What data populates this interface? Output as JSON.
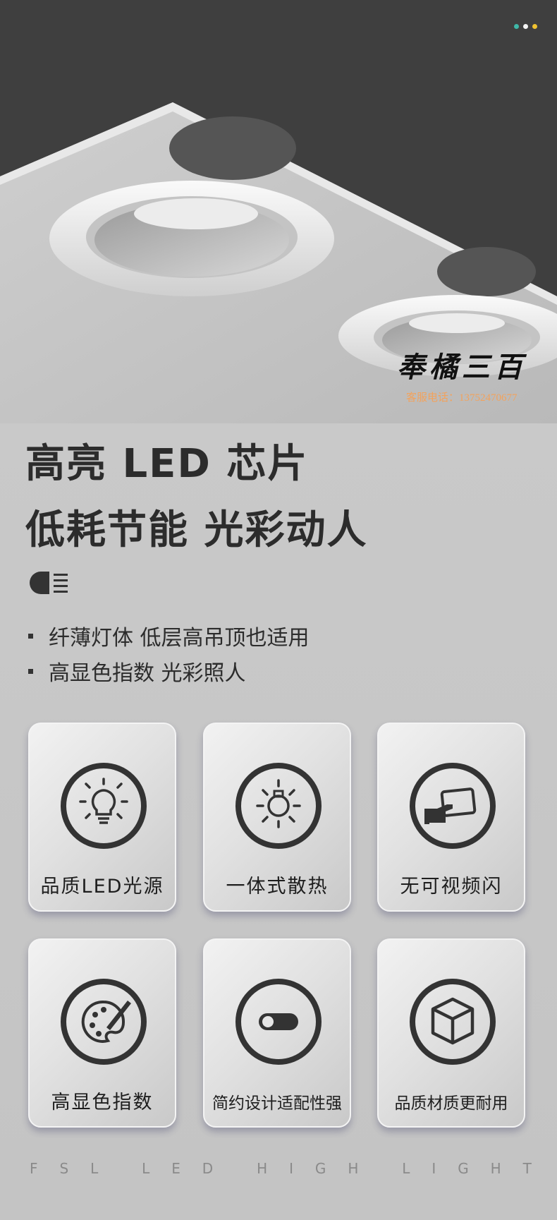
{
  "colors": {
    "dark_bg": "#3f3f3f",
    "text": "#2c2c2c",
    "phone": "#f3a25b",
    "dot_teal": "#3fb8a8",
    "dot_white": "#f5f5f5",
    "dot_yellow": "#f0c230"
  },
  "seal": {
    "title": "奉橘三百",
    "phone": "客服电话：13752470677"
  },
  "headline": {
    "line1": "高亮 LED 芯片",
    "line2": "低耗节能 光彩动人"
  },
  "features": [
    "纤薄灯体 低层高吊顶也适用",
    "高显色指数 光彩照人"
  ],
  "cards": [
    {
      "label": "品质LED光源",
      "icon": "lightbulb-icon"
    },
    {
      "label": "一体式散热",
      "icon": "sun-bulb-icon"
    },
    {
      "label": "无可视频闪",
      "icon": "hand-phone-icon"
    },
    {
      "label": "高显色指数",
      "icon": "palette-icon"
    },
    {
      "label": "简约设计适配性强",
      "icon": "toggle-icon"
    },
    {
      "label": "品质材质更耐用",
      "icon": "cube-icon"
    }
  ],
  "footer": [
    "F",
    "S",
    "L",
    "",
    "L",
    "E",
    "D",
    "",
    "H",
    "I",
    "G",
    "H",
    "",
    "L",
    "I",
    "G",
    "H",
    "T"
  ]
}
